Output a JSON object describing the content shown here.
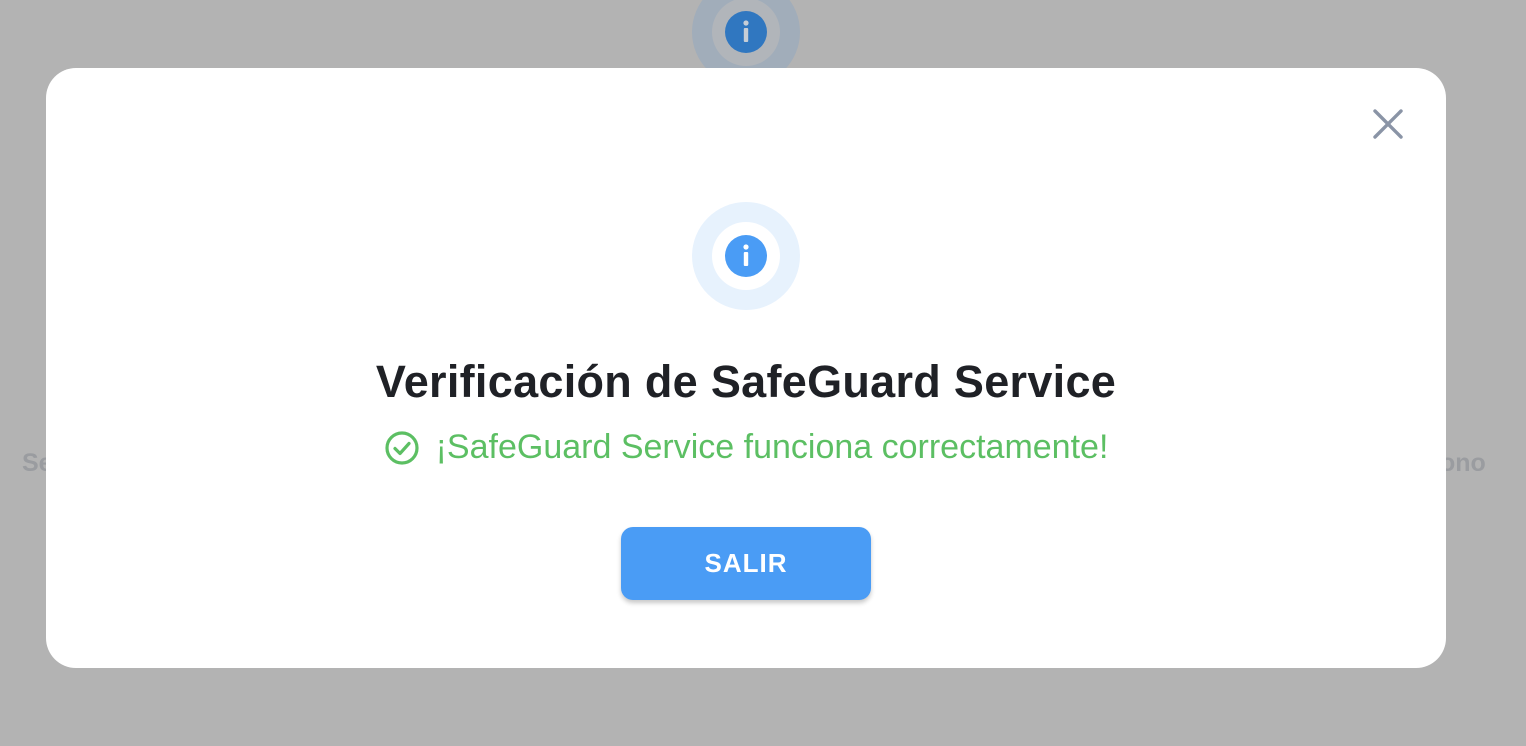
{
  "background": {
    "left_text": "Se",
    "right_text": "ono",
    "icon": "info-icon"
  },
  "modal": {
    "close_icon": "close-icon",
    "header_icon": "info-icon",
    "title": "Verificación de SafeGuard Service",
    "status_icon": "check-circle-icon",
    "status_text": "¡SafeGuard Service funciona correctamente!",
    "exit_button_label": "SALIR"
  },
  "colors": {
    "primary": "#4a9cf5",
    "success": "#5cbf63",
    "title": "#1f2126",
    "overlay": "#b3b3b3",
    "close_icon": "#8a94a6"
  }
}
